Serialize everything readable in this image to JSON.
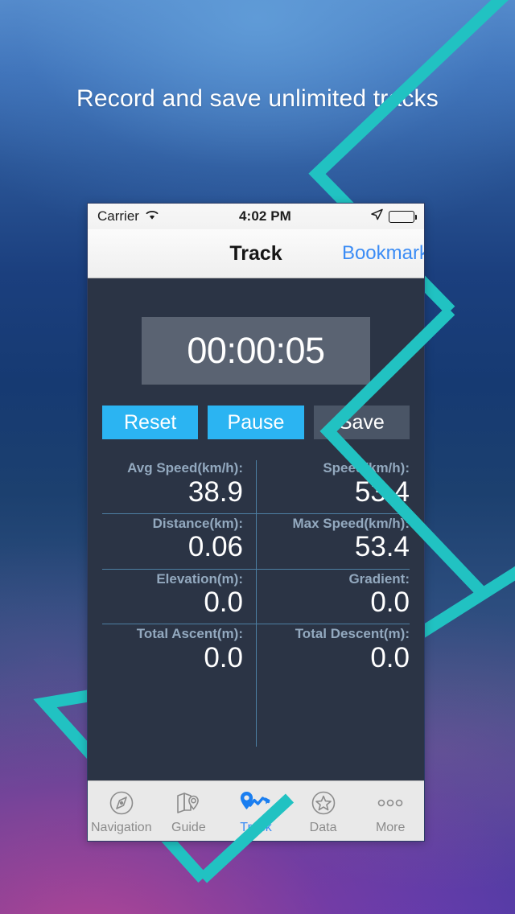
{
  "headline": "Record and save unlimited tracks",
  "colors": {
    "accent_teal": "#21c2c2",
    "accent_blue": "#2bb4f2",
    "link_blue": "#3b8cf5",
    "panel_dark": "#2b3445",
    "timer_panel": "#5a6372",
    "muted_button": "#4a5566",
    "stat_label": "#93a9bf",
    "divider": "#4d7fa3"
  },
  "phone": {
    "statusbar": {
      "carrier": "Carrier",
      "wifi_icon": "wifi-icon",
      "time": "4:02 PM",
      "location_icon": "location-arrow-icon",
      "battery_icon": "battery-icon"
    },
    "navbar": {
      "title": "Track",
      "right_action": "Bookmark"
    },
    "timer": {
      "value": "00:00:05"
    },
    "buttons": [
      {
        "label": "Reset",
        "style": "primary"
      },
      {
        "label": "Pause",
        "style": "primary"
      },
      {
        "label": "Save",
        "style": "muted"
      }
    ],
    "stats": [
      [
        {
          "label": "Avg Speed(km/h):",
          "value": "38.9"
        },
        {
          "label": "Speed(km/h):",
          "value": "53.4"
        }
      ],
      [
        {
          "label": "Distance(km):",
          "value": "0.06"
        },
        {
          "label": "Max Speed(km/h):",
          "value": "53.4"
        }
      ],
      [
        {
          "label": "Elevation(m):",
          "value": "0.0"
        },
        {
          "label": "Gradient:",
          "value": "0.0"
        }
      ],
      [
        {
          "label": "Total Ascent(m):",
          "value": "0.0"
        },
        {
          "label": "Total Descent(m):",
          "value": "0.0"
        }
      ]
    ],
    "tabs": [
      {
        "label": "Navigation",
        "icon": "compass-icon",
        "active": false
      },
      {
        "label": "Guide",
        "icon": "map-icon",
        "active": false
      },
      {
        "label": "Track",
        "icon": "track-pin-route-icon",
        "active": true
      },
      {
        "label": "Data",
        "icon": "star-circle-icon",
        "active": false
      },
      {
        "label": "More",
        "icon": "ellipsis-icon",
        "active": false
      }
    ]
  }
}
